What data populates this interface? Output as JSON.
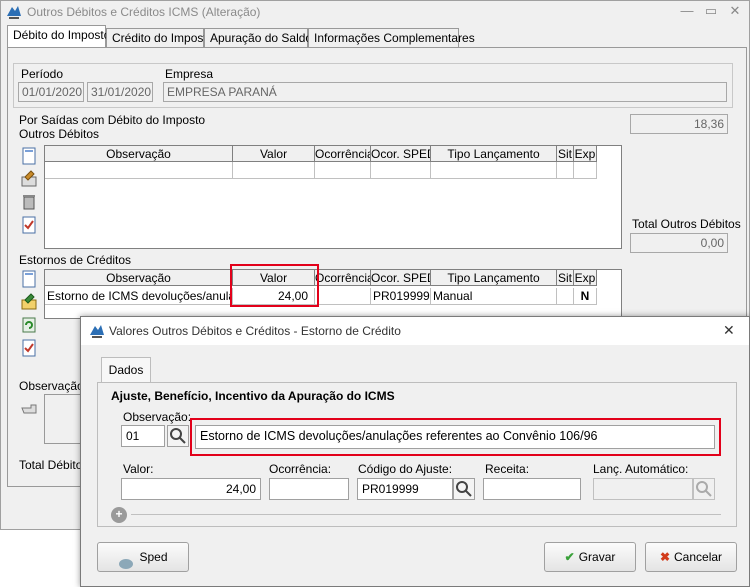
{
  "main_window": {
    "title": "Outros Débitos e Créditos ICMS (Alteração)",
    "tabs": [
      "Débito do Imposto",
      "Crédito do Imposto",
      "Apuração do Saldo",
      "Informações Complementares"
    ],
    "periodo_label": "Período",
    "periodo_inicio": "01/01/2020",
    "periodo_fim": "31/01/2020",
    "empresa_label": "Empresa",
    "empresa_value": "EMPRESA PARANÁ",
    "section_saidas": "Por Saídas com Débito do Imposto",
    "outros_debitos_label": "Outros Débitos",
    "saidas_value": "18,36",
    "total_outros_debitos_label": "Total Outros Débitos",
    "total_outros_debitos_value": "0,00",
    "estornos_label": "Estornos de Créditos",
    "observacao_label": "Observação",
    "total_debitos_label": "Total Débitos",
    "columns": [
      "Observação",
      "Valor",
      "Ocorrência",
      "Ocor. SPED",
      "Tipo Lançamento",
      "Sit",
      "Exp"
    ],
    "estorno_row": {
      "observacao": "Estorno de ICMS devoluções/anulaçõ",
      "valor": "24,00",
      "ocorrencia": "",
      "ocor_sped": "PR019999",
      "tipo": "Manual",
      "sit": "",
      "exp": "N"
    }
  },
  "dialog": {
    "title": "Valores Outros Débitos e Créditos - Estorno de Crédito",
    "tab": "Dados",
    "section_title": "Ajuste, Benefício, Incentivo da Apuração do ICMS",
    "observacao_label": "Observação:",
    "observacao_code": "01",
    "observacao_text": "Estorno de ICMS devoluções/anulações referentes ao Convênio 106/96",
    "valor_label": "Valor:",
    "valor_value": "24,00",
    "ocorrencia_label": "Ocorrência:",
    "ocorrencia_value": "",
    "codigo_label": "Código do Ajuste:",
    "codigo_value": "PR019999",
    "receita_label": "Receita:",
    "receita_value": "",
    "lanc_label": "Lanç. Automático:",
    "lanc_value": "",
    "sped_button": "Sped",
    "gravar_button": "Gravar",
    "cancelar_button": "Cancelar"
  },
  "colors": {
    "highlight": "#e2001a",
    "accent_blue": "#1f4f9c"
  },
  "icons": [
    "app-icon",
    "close-icon",
    "minimize-icon",
    "maximize-icon",
    "new-doc-icon",
    "edit-icon",
    "delete-icon",
    "calc-icon",
    "search-icon",
    "add-icon",
    "check-icon",
    "cancel-icon",
    "sped-icon"
  ]
}
